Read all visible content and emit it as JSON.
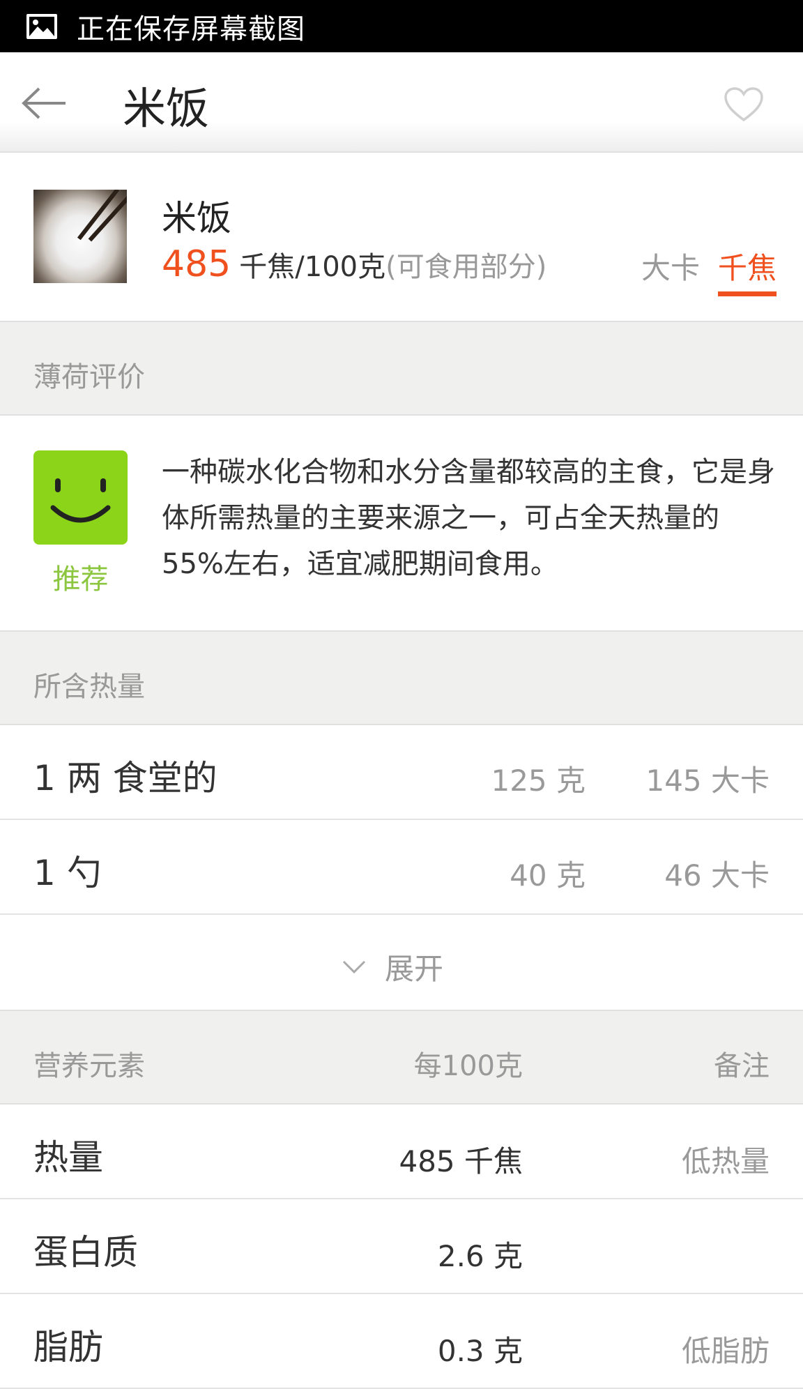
{
  "status_bar": {
    "text": "正在保存屏幕截图",
    "icon": "image-icon"
  },
  "app_bar": {
    "title": "米饭",
    "back_icon": "back-arrow-icon",
    "favorite_icon": "heart-outline-icon"
  },
  "food": {
    "name": "米饭",
    "energy_value": "485",
    "energy_unit": "千焦/100克",
    "energy_note": "(可食用部分)",
    "unit_options": [
      "大卡",
      "千焦"
    ],
    "selected_unit": "千焦",
    "accent_color": "#f0501e"
  },
  "evaluation": {
    "section_title": "薄荷评价",
    "badge_label": "推荐",
    "badge_color": "#8cd419",
    "text": "一种碳水化合物和水分含量都较高的主食，它是身体所需热量的主要来源之一，可占全天热量的55%左右，适宜减肥期间食用。"
  },
  "calories": {
    "section_title": "所含热量",
    "rows": [
      {
        "name": "1 两 食堂的",
        "weight": "125 克",
        "cal": "145 大卡"
      },
      {
        "name": "1 勺",
        "weight": "40 克",
        "cal": "46 大卡"
      }
    ],
    "expand_label": "展开"
  },
  "nutrition": {
    "header": {
      "name": "营养元素",
      "per": "每100克",
      "note": "备注"
    },
    "rows": [
      {
        "name": "热量",
        "value": "485 千焦",
        "note": "低热量"
      },
      {
        "name": "蛋白质",
        "value": "2.6 克",
        "note": ""
      },
      {
        "name": "脂肪",
        "value": "0.3 克",
        "note": "低脂肪"
      }
    ]
  }
}
